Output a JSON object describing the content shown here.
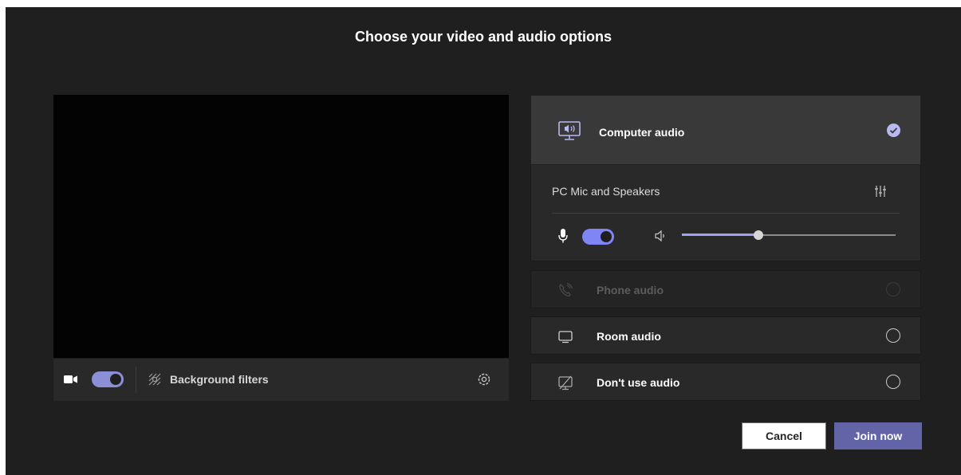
{
  "dialog": {
    "title": "Choose your video and audio options"
  },
  "video": {
    "camera_on": true,
    "background_filters_label": "Background filters"
  },
  "audio": {
    "computer_audio": {
      "label": "Computer audio",
      "selected": true,
      "device_label": "PC Mic and Speakers",
      "mic_on": true,
      "speaker_volume": 0.36
    },
    "options": [
      {
        "label": "Phone audio",
        "enabled": false,
        "icon": "phone-icon"
      },
      {
        "label": "Room audio",
        "enabled": true,
        "icon": "room-icon"
      },
      {
        "label": "Don't use audio",
        "enabled": true,
        "icon": "no-audio-icon"
      }
    ]
  },
  "actions": {
    "cancel_label": "Cancel",
    "join_label": "Join now"
  },
  "colors": {
    "accent": "#6264a7",
    "toggle_on": "#7f85f5",
    "background": "#1f1f1f"
  }
}
